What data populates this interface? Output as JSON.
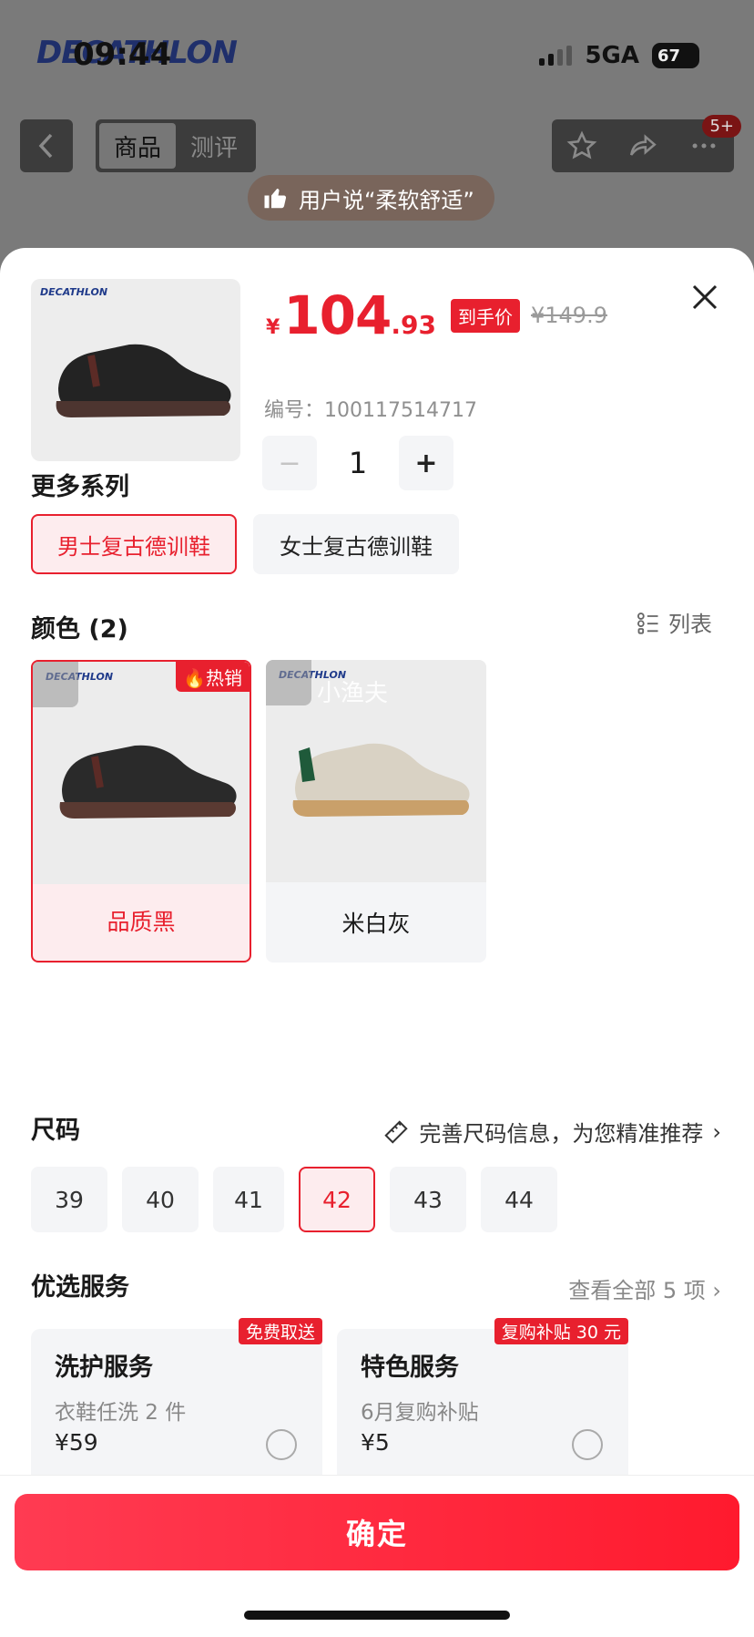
{
  "status": {
    "time": "09:44",
    "network": "5GA",
    "battery": "67"
  },
  "background": {
    "brand": "DECATHLON",
    "tabs": [
      "商品",
      "测评"
    ],
    "badge": "5+",
    "tip": "用户说“柔软舒适”"
  },
  "product": {
    "brand": "DECATHLON",
    "price_symbol": "¥",
    "price_int": "104",
    "price_dec": ".93",
    "price_tag": "到手价",
    "original_price": "¥149.9",
    "sku_label": "编号：100117514717",
    "quantity": "1"
  },
  "series": {
    "title": "更多系列",
    "options": [
      {
        "label": "男士复古德训鞋",
        "selected": true
      },
      {
        "label": "女士复古德训鞋",
        "selected": false
      }
    ]
  },
  "colors": {
    "title": "颜色 (2)",
    "list_label": "列表",
    "hot_label": "热销",
    "watermark": "小渔夫",
    "options": [
      {
        "label": "品质黑",
        "selected": true,
        "shoe_color": "#2a2a2a",
        "sole_color": "#5a3a32"
      },
      {
        "label": "米白灰",
        "selected": false,
        "shoe_color": "#d9d2c4",
        "sole_color": "#c9a06a"
      }
    ]
  },
  "size": {
    "title": "尺码",
    "hint": "完善尺码信息，为您精准推荐",
    "options": [
      "39",
      "40",
      "41",
      "42",
      "43",
      "44"
    ],
    "selected": "42"
  },
  "services": {
    "title": "优选服务",
    "more": "查看全部 5 项 ›",
    "items": [
      {
        "title": "洗护服务",
        "sub": "衣鞋任洗 2 件",
        "price": "¥59",
        "tag": "免费取送"
      },
      {
        "title": "特色服务",
        "sub": "6月复购补贴",
        "price": "¥5",
        "tag": "复购补贴 30 元"
      }
    ]
  },
  "confirm_label": "确定",
  "accent": "#e8202e"
}
